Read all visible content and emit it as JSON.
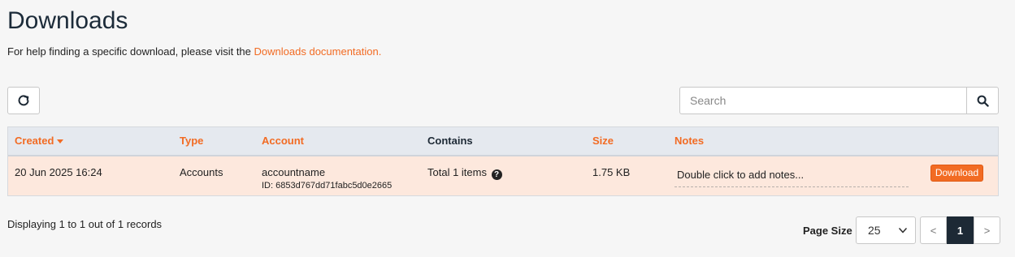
{
  "page": {
    "title": "Downloads",
    "help_prefix": "For help finding a specific download, please visit the",
    "help_link": "Downloads documentation."
  },
  "toolbar": {
    "refresh_icon": "refresh-icon",
    "search_placeholder": "Search",
    "search_value": "",
    "search_icon": "search-icon"
  },
  "table": {
    "columns": [
      "Created",
      "Type",
      "Account",
      "Contains",
      "Size",
      "Notes"
    ],
    "sort_column": "Created",
    "rows": [
      {
        "created": "20 Jun 2025 16:24",
        "type": "Accounts",
        "account": "accountname",
        "account_id": "ID: 6853d767dd71fabc5d0e2665",
        "contains": "Total 1 items",
        "size": "1.75 KB",
        "notes": "Double click to add notes...",
        "action": "Download"
      }
    ]
  },
  "footer": {
    "records_text": "Displaying 1 to 1 out of 1 records",
    "page_size_label": "Page Size",
    "page_size_value": "25",
    "prev_label": "<",
    "current_page": "1",
    "next_label": ">"
  },
  "colors": {
    "accent": "#f26b23",
    "header_bg": "#e5e9ef",
    "row_highlight": "#fde8dd",
    "active_page": "#1d2935"
  }
}
